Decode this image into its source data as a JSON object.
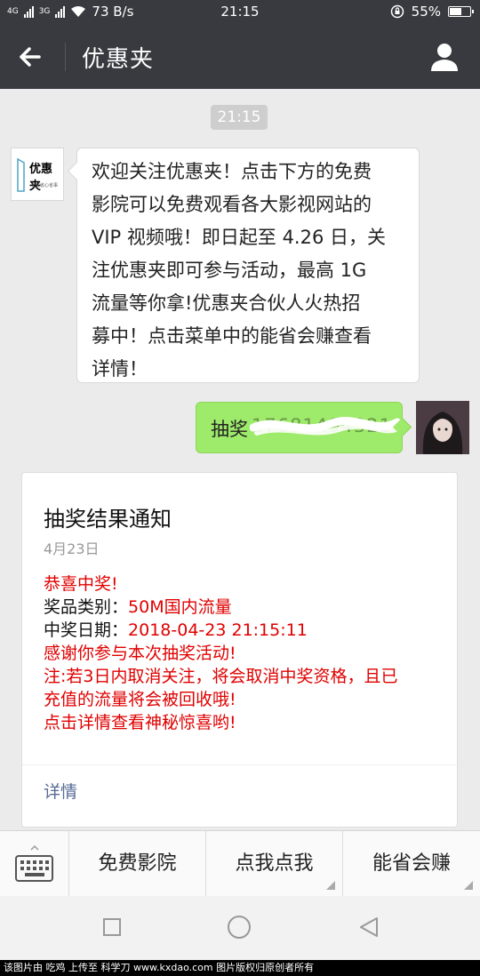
{
  "status_bar": {
    "signal1": "4G",
    "signal2": "3G",
    "net_speed": "73 B/s",
    "time": "21:15",
    "battery": "55%"
  },
  "header": {
    "title": "优惠夹"
  },
  "chat": {
    "time_divider": "21:15",
    "bot_avatar": {
      "logo_text": "优惠夹",
      "logo_sub": "省钱省心省事"
    },
    "welcome_lines": [
      "欢迎关注优惠夹！点击下方的免费",
      "影院可以免费观看各大影视网站的",
      "VIP 视频哦！即日起至 4.26 日，关",
      "注优惠夹即可参与活动，最高 1G",
      "流量等你拿!优惠夹合伙人火热招",
      "募中！点击菜单中的能省会赚查看",
      "详情！"
    ],
    "user_message_prefix": "抽奖",
    "user_message_phone": "17681494321"
  },
  "card": {
    "title": "抽奖结果通知",
    "date": "4月23日",
    "congrats": "恭喜中奖!",
    "prize_label": "奖品类别：",
    "prize_value": "50M国内流量",
    "date_label": "中奖日期：",
    "date_value": "2018-04-23 21:15:11",
    "thanks": "感谢你参与本次抽奖活动!",
    "notice_line1": "注:若3日内取消关注，将会取消中奖资格，且已",
    "notice_line2": "充值的流量将会被回收哦!",
    "cta": "点击详情查看神秘惊喜哟!",
    "detail_link": "详情"
  },
  "menu": {
    "items": [
      "免费影院",
      "点我点我",
      "能省会赚"
    ]
  },
  "footer": {
    "text": "该图片由 吃鸡 上传至 科学刀 www.kxdao.com 图片版权归原创者所有"
  },
  "colors": {
    "header_bg": "#393a3f",
    "chat_bg": "#ebebeb",
    "user_bubble": "#9eea6a",
    "card_red": "#e00000",
    "link_blue": "#576b95"
  }
}
